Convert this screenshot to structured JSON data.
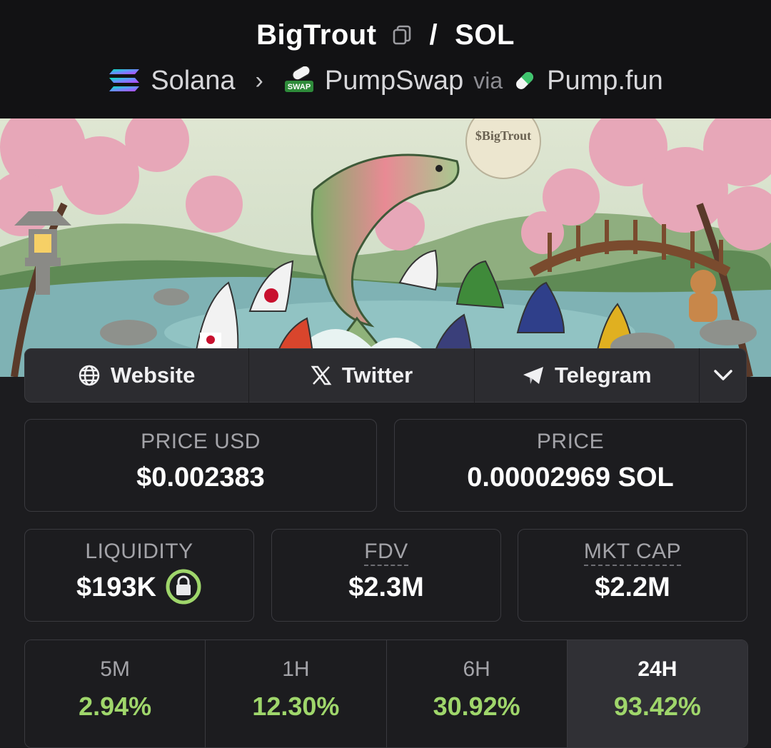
{
  "header": {
    "token": "BigTrout",
    "separator": "/",
    "quote": "SOL",
    "chain": "Solana",
    "dex": "PumpSwap",
    "dex_badge": "SWAP",
    "via": "via",
    "launchpad": "Pump.fun"
  },
  "banner": {
    "watermark": "$BigTrout"
  },
  "links": [
    {
      "label": "Website",
      "icon": "globe-icon"
    },
    {
      "label": "Twitter",
      "icon": "x-icon"
    },
    {
      "label": "Telegram",
      "icon": "telegram-icon"
    },
    {
      "icon": "chevron-down-icon"
    }
  ],
  "stats": {
    "price_usd_label": "PRICE USD",
    "price_usd": "$0.002383",
    "price_label": "PRICE",
    "price": "0.00002969 SOL",
    "liquidity_label": "LIQUIDITY",
    "liquidity": "$193K",
    "fdv_label": "FDV",
    "fdv": "$2.3M",
    "mktcap_label": "MKT CAP",
    "mktcap": "$2.2M"
  },
  "changes": [
    {
      "label": "5M",
      "value": "2.94%"
    },
    {
      "label": "1H",
      "value": "12.30%"
    },
    {
      "label": "6H",
      "value": "30.92%"
    },
    {
      "label": "24H",
      "value": "93.42%",
      "active": true
    }
  ],
  "colors": {
    "positive": "#9fd66b",
    "background": "#1c1c1f",
    "header": "#121214"
  }
}
